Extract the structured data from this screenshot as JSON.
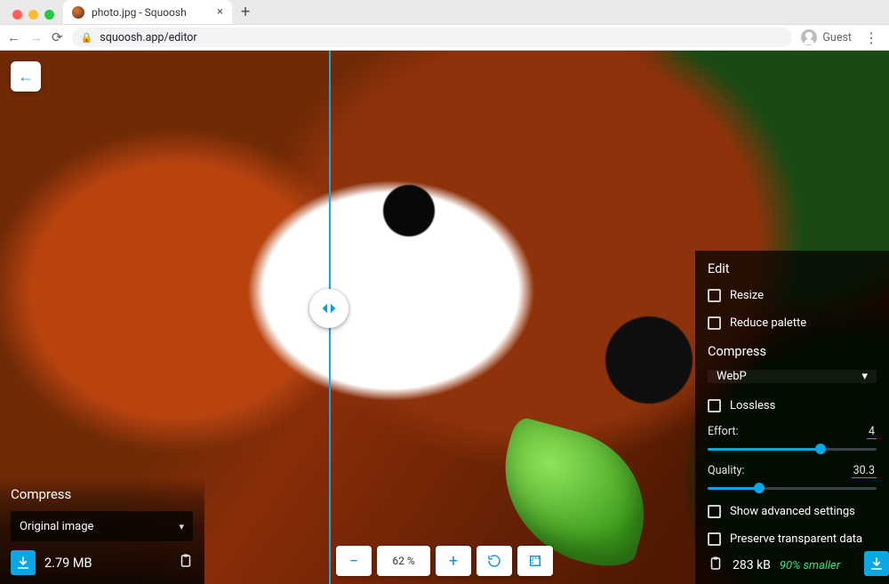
{
  "browser": {
    "tab_title": "photo.jpg - Squoosh",
    "url": "squoosh.app/editor",
    "guest_label": "Guest"
  },
  "compare": {
    "divider_percent": 37
  },
  "left": {
    "section_title": "Compress",
    "format_selected": "Original image",
    "file_size": "2.79 MB"
  },
  "center": {
    "zoom_label": "62 %"
  },
  "right": {
    "edit_title": "Edit",
    "resize_label": "Resize",
    "reduce_palette_label": "Reduce palette",
    "compress_title": "Compress",
    "format_selected": "WebP",
    "lossless_label": "Lossless",
    "effort_label": "Effort:",
    "effort_value": "4",
    "effort_min": 0,
    "effort_max": 6,
    "quality_label": "Quality:",
    "quality_value": "30.3",
    "quality_min": 0,
    "quality_max": 100,
    "advanced_label": "Show advanced settings",
    "preserve_transparent_label": "Preserve transparent data",
    "file_size": "283 kB",
    "savings_label": "90% smaller"
  },
  "colors": {
    "accent": "#0aa7e4"
  }
}
